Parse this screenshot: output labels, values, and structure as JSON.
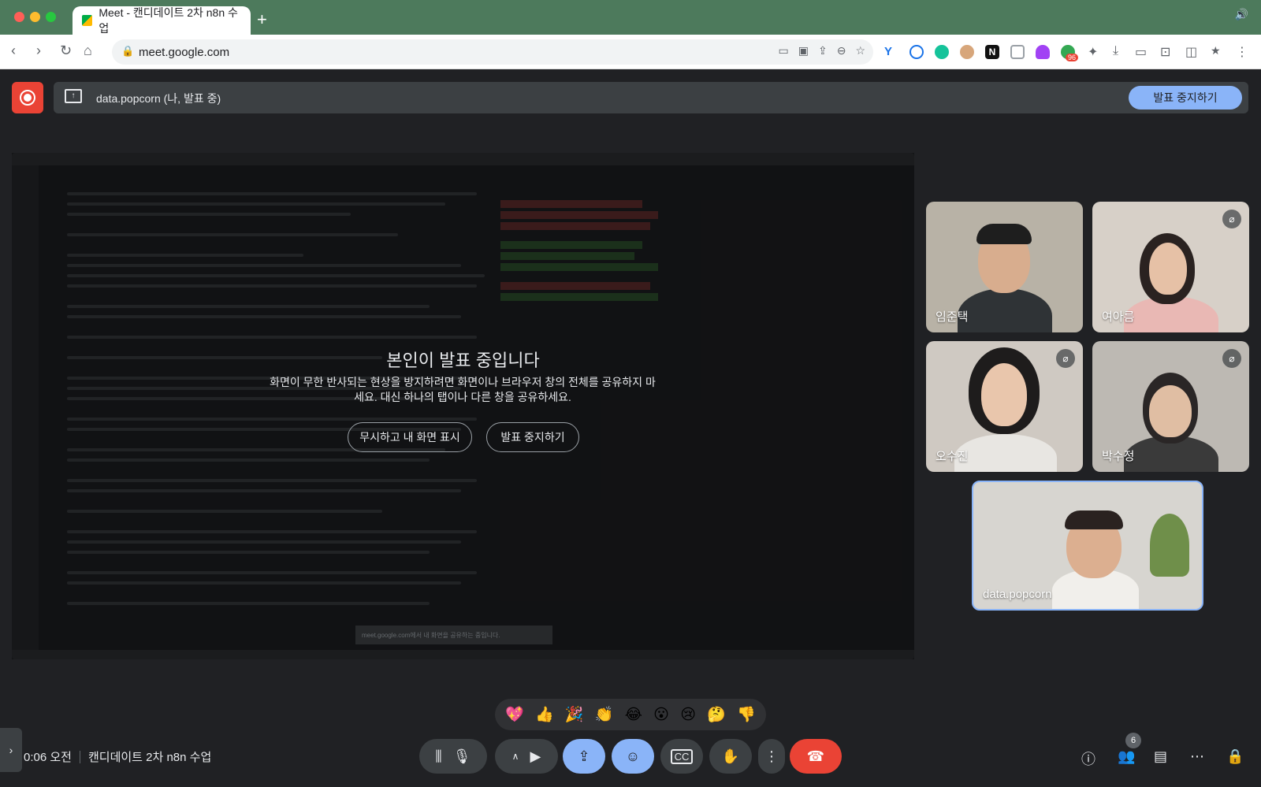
{
  "browser": {
    "tab_title": "Meet - 캔디데이트 2차 n8n 수업",
    "new_tab": "+",
    "url": "meet.google.com",
    "extension_badge": "96",
    "extension_n": "N"
  },
  "banner": {
    "presenter_label": "data.popcorn (나, 발표 중)",
    "stop_label": "발표 중지하기"
  },
  "overlay": {
    "title": "본인이 발표 중입니다",
    "body": "화면이 무한 반사되는 현상을 방지하려면 화면이나 브라우저 창의 전체를 공유하지 마세요. 대신 하나의 탭이나 다른 창을 공유하세요.",
    "show_anyway": "무시하고 내 화면 표시",
    "stop": "발표 중지하기",
    "share_notice": "meet.google.com에서 내 화면을 공유하는 중입니다."
  },
  "participants": [
    {
      "name": "임준택",
      "muted": false
    },
    {
      "name": "여아름",
      "muted": true
    },
    {
      "name": "오수진",
      "muted": true
    },
    {
      "name": "박수정",
      "muted": true
    },
    {
      "name": "data.popcorn",
      "muted": false
    }
  ],
  "reactions": [
    "💖",
    "👍",
    "🎉",
    "👏",
    "😂",
    "😮",
    "😢",
    "🤔",
    "👎"
  ],
  "footer": {
    "time": "0:06 오전",
    "meeting_name": "캔디데이트 2차 n8n 수업",
    "people_count": "6"
  },
  "colors": {
    "accent": "#8ab4f8",
    "end_call": "#ea4335",
    "background": "#202124",
    "titlebar": "#4d7a5c"
  }
}
